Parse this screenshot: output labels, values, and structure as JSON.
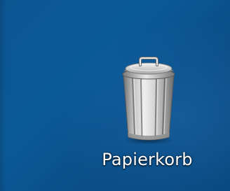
{
  "desktop": {
    "background_color": "#0b5592",
    "icons": [
      {
        "icon": "trash-can-icon",
        "label": "Papierkorb"
      }
    ]
  }
}
